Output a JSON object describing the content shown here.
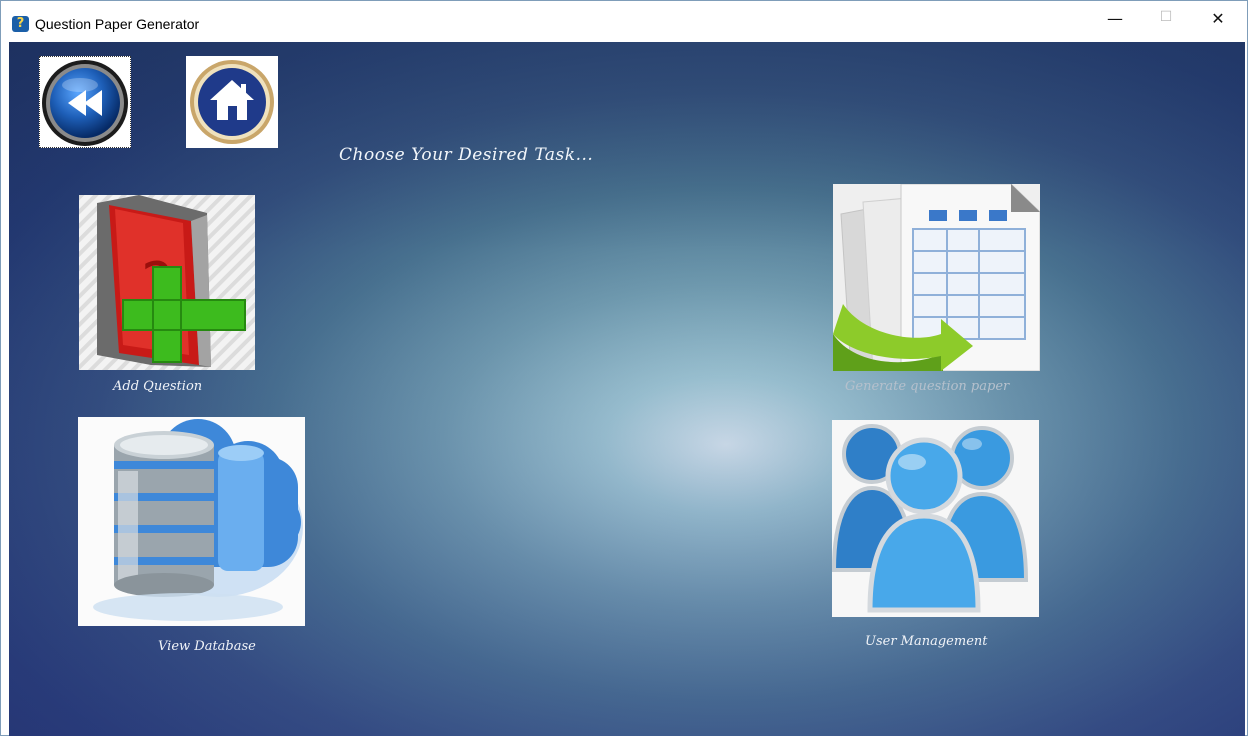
{
  "window": {
    "title": "Question Paper Generator",
    "minimize_glyph": "—",
    "maximize_glyph": "☐",
    "close_glyph": "✕"
  },
  "nav": {
    "back_icon": "rewind-icon",
    "home_icon": "home-icon"
  },
  "main": {
    "heading": "Choose Your Desired Task..."
  },
  "tasks": [
    {
      "label": "Add Question",
      "icon": "add-question-book-icon"
    },
    {
      "label": "Generate question paper",
      "icon": "generate-paper-icon"
    },
    {
      "label": "View Database",
      "icon": "database-cloud-icon"
    },
    {
      "label": "User Management",
      "icon": "users-icon"
    }
  ],
  "colors": {
    "title_icon": "#1b5fa8",
    "back_button": "#1e5fb8",
    "home_button": "#1f3a8a",
    "book_red": "#d3211f",
    "plus_green": "#3dbb1e",
    "generate_arrow": "#8dcb2a",
    "database_blue": "#3e88d9",
    "user_blue": "#3a9ae0"
  }
}
